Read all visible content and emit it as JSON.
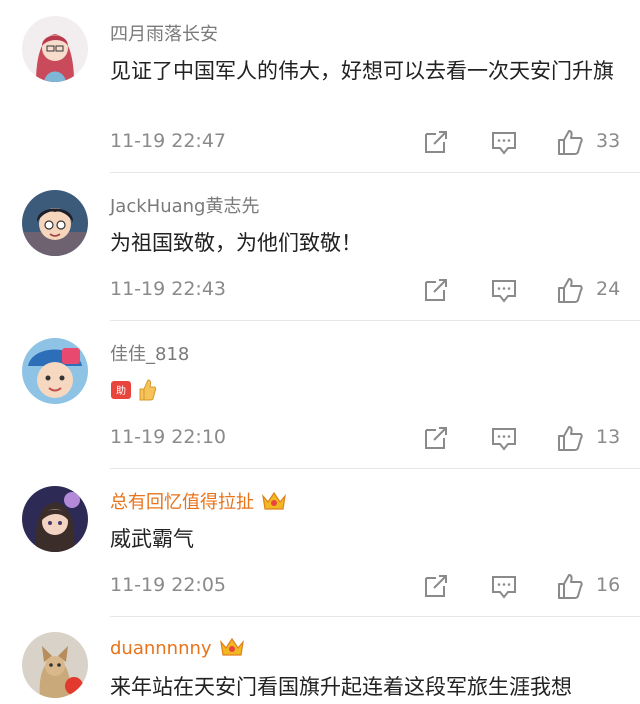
{
  "comments": [
    {
      "username": "四月雨落长安",
      "vip": false,
      "text": "见证了中国军人的伟大，好想可以去看一次天安门升旗",
      "time": "11-19 22:47",
      "likes": "33"
    },
    {
      "username": "JackHuang黄志先",
      "vip": false,
      "text": "为祖国致敬，为他们致敬！",
      "time": "11-19 22:43",
      "likes": "24"
    },
    {
      "username": "佳佳_818",
      "vip": false,
      "text": "",
      "emojis": [
        "help-sticker",
        "thumbs-up-emoji"
      ],
      "time": "11-19 22:10",
      "likes": "13"
    },
    {
      "username": "总有回忆值得拉扯",
      "vip": true,
      "text": "威武霸气",
      "time": "11-19 22:05",
      "likes": "16"
    },
    {
      "username": "duannnnny",
      "vip": true,
      "text": "来年站在天安门看国旗升起连着这段军旅生涯我想",
      "time": "",
      "likes": ""
    }
  ],
  "icons": {
    "share": "share-icon",
    "comment": "comment-icon",
    "like": "like-icon",
    "vip": "crown-vip-icon"
  },
  "colors": {
    "username": "#7a7a7a",
    "vip_username": "#e8731a",
    "text": "#222222",
    "meta": "#8a8a8a"
  }
}
